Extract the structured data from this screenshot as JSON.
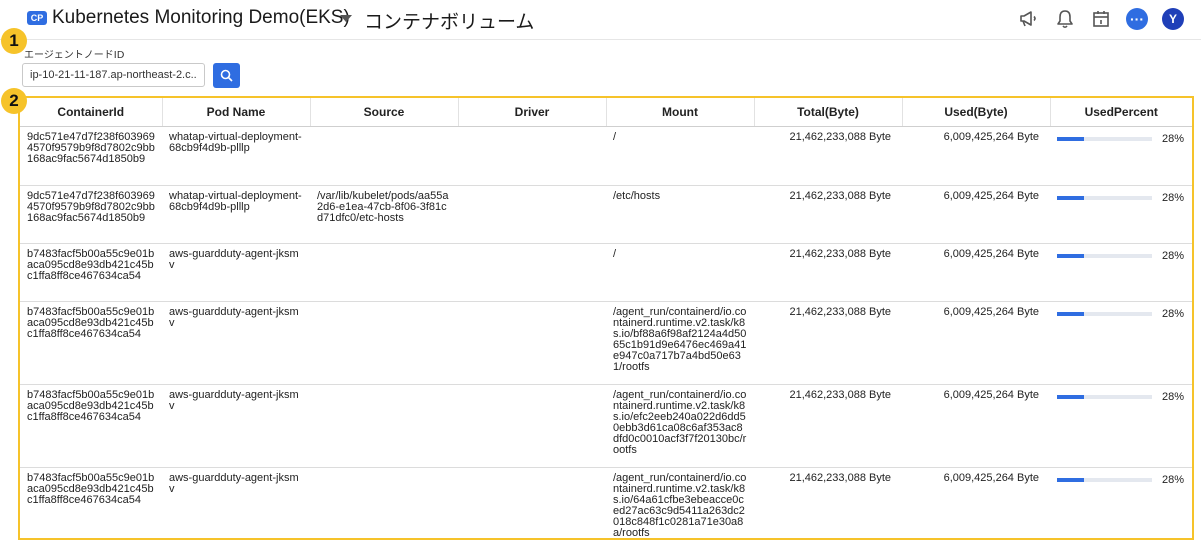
{
  "header": {
    "badge": "CP",
    "project_name": "Kubernetes Monitoring Demo(EKS)",
    "page_title": "コンテナボリューム",
    "avatar_letter": "Y",
    "more_glyph": "···",
    "icons": [
      "megaphone-icon",
      "bell-icon",
      "calendar-icon",
      "more-icon",
      "avatar"
    ]
  },
  "markers": {
    "first": "1",
    "second": "2"
  },
  "filter": {
    "label": "エージェントノードID",
    "value": "ip-10-21-11-187.ap-northeast-2.c..."
  },
  "table": {
    "columns": [
      "ContainerId",
      "Pod Name",
      "Source",
      "Driver",
      "Mount",
      "Total(Byte)",
      "Used(Byte)",
      "UsedPercent"
    ],
    "rows": [
      {
        "container_id": "9dc571e47d7f238f6039694570f9579b9f8d7802c9bb168ac9fac5674d1850b9",
        "pod_name": "whatap-virtual-deployment-68cb9f4d9b-plllp",
        "source": "",
        "driver": "",
        "mount": "/",
        "total": "21,462,233,088 Byte",
        "used": "6,009,425,264 Byte",
        "used_percent": 28,
        "used_percent_label": "28%"
      },
      {
        "container_id": "9dc571e47d7f238f6039694570f9579b9f8d7802c9bb168ac9fac5674d1850b9",
        "pod_name": "whatap-virtual-deployment-68cb9f4d9b-plllp",
        "source": "/var/lib/kubelet/pods/aa55a2d6-e1ea-47cb-8f06-3f81cd71dfc0/etc-hosts",
        "driver": "",
        "mount": "/etc/hosts",
        "total": "21,462,233,088 Byte",
        "used": "6,009,425,264 Byte",
        "used_percent": 28,
        "used_percent_label": "28%"
      },
      {
        "container_id": "b7483facf5b00a55c9e01baca095cd8e93db421c45bc1ffa8ff8ce467634ca54",
        "pod_name": "aws-guardduty-agent-jksmv",
        "source": "",
        "driver": "",
        "mount": "/",
        "total": "21,462,233,088 Byte",
        "used": "6,009,425,264 Byte",
        "used_percent": 28,
        "used_percent_label": "28%"
      },
      {
        "container_id": "b7483facf5b00a55c9e01baca095cd8e93db421c45bc1ffa8ff8ce467634ca54",
        "pod_name": "aws-guardduty-agent-jksmv",
        "source": "",
        "driver": "",
        "mount": "/agent_run/containerd/io.containerd.runtime.v2.task/k8s.io/bf88a6f98af2124a4d5065c1b91d9e6476ec469a41e947c0a717b7a4bd50e631/rootfs",
        "total": "21,462,233,088 Byte",
        "used": "6,009,425,264 Byte",
        "used_percent": 28,
        "used_percent_label": "28%"
      },
      {
        "container_id": "b7483facf5b00a55c9e01baca095cd8e93db421c45bc1ffa8ff8ce467634ca54",
        "pod_name": "aws-guardduty-agent-jksmv",
        "source": "",
        "driver": "",
        "mount": "/agent_run/containerd/io.containerd.runtime.v2.task/k8s.io/efc2eeb240a022d6dd50ebb3d61ca08c6af353ac8dfd0c0010acf3f7f20130bc/rootfs",
        "total": "21,462,233,088 Byte",
        "used": "6,009,425,264 Byte",
        "used_percent": 28,
        "used_percent_label": "28%"
      },
      {
        "container_id": "b7483facf5b00a55c9e01baca095cd8e93db421c45bc1ffa8ff8ce467634ca54",
        "pod_name": "aws-guardduty-agent-jksmv",
        "source": "",
        "driver": "",
        "mount": "/agent_run/containerd/io.containerd.runtime.v2.task/k8s.io/64a61cfbe3ebeacce0ced27ac63c9d5411a263dc2018c848f1c0281a71e30a8a/rootfs",
        "total": "21,462,233,088 Byte",
        "used": "6,009,425,264 Byte",
        "used_percent": 28,
        "used_percent_label": "28%"
      }
    ]
  },
  "colors": {
    "accent": "#2f6de1",
    "highlight": "#f6c32a",
    "avatar": "#1f3fb8"
  }
}
